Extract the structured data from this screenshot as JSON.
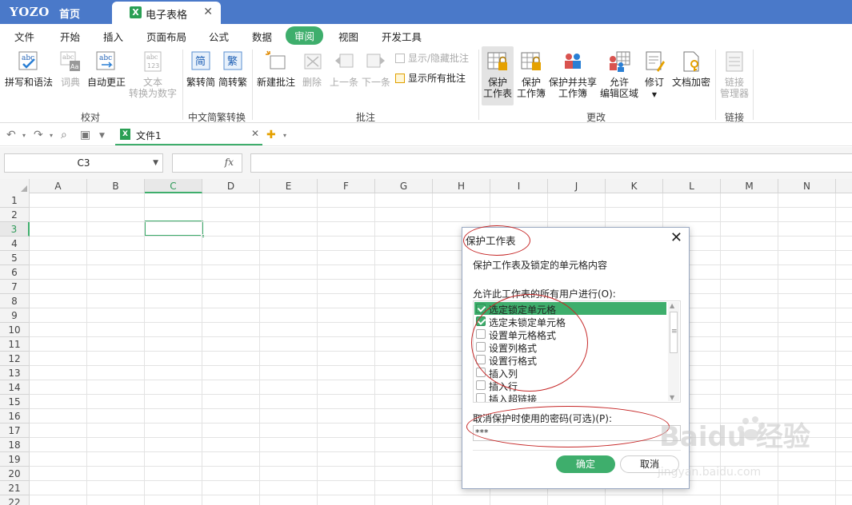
{
  "titlebar": {
    "logo": "YOZO",
    "home_tab": "首页",
    "doc_tab": "电子表格",
    "close_glyph": "✕",
    "bg_color": "#4a79c9"
  },
  "menu": {
    "items": [
      "文件",
      "开始",
      "插入",
      "页面布局",
      "公式",
      "数据",
      "审阅",
      "视图",
      "开发工具"
    ],
    "active": "审阅"
  },
  "ribbon": {
    "proofing": {
      "spell": "拼写和语法",
      "dict": "词典",
      "autocorrect": "自动更正",
      "text_convert_1": "文本",
      "text_convert_2": "转换为数字",
      "label": "校对"
    },
    "chinese": {
      "trad": "繁转简",
      "simp": "简转繁",
      "label": "中文简繁转换"
    },
    "comments": {
      "new": "新建批注",
      "delete": "删除",
      "prev": "上一条",
      "next": "下一条",
      "show_hide": "显示/隐藏批注",
      "show_all": "显示所有批注",
      "label": "批注"
    },
    "changes": {
      "protect_sheet_1": "保护",
      "protect_sheet_2": "工作表",
      "protect_book_1": "保护",
      "protect_book_2": "工作簿",
      "share_1": "保护并共享",
      "share_2": "工作簿",
      "allow_1": "允许",
      "allow_2": "编辑区域",
      "revise": "修订",
      "encrypt": "文档加密",
      "label": "更改"
    },
    "links": {
      "manager_1": "链接",
      "manager_2": "管理器",
      "label": "链接"
    }
  },
  "quickbar": {
    "file_tab": "文件1",
    "close_glyph": "✕"
  },
  "formula_bar": {
    "name_box": "C3",
    "fx": "fx",
    "formula": ""
  },
  "grid": {
    "columns": [
      "A",
      "B",
      "C",
      "D",
      "E",
      "F",
      "G",
      "H",
      "I",
      "J",
      "K",
      "L",
      "M",
      "N"
    ],
    "rows": [
      "1",
      "2",
      "3",
      "4",
      "5",
      "6",
      "7",
      "8",
      "9",
      "10",
      "11",
      "12",
      "13",
      "14",
      "15",
      "16",
      "17",
      "18",
      "19",
      "20",
      "21",
      "22"
    ],
    "active_column": "C",
    "active_row": "3"
  },
  "dialog": {
    "title": "保护工作表",
    "close_glyph": "✕",
    "description": "保护工作表及锁定的单元格内容",
    "allow_label": "允许此工作表的所有用户进行(O):",
    "permissions": [
      {
        "label": "选定锁定单元格",
        "checked": true
      },
      {
        "label": "选定未锁定单元格",
        "checked": true
      },
      {
        "label": "设置单元格格式",
        "checked": false
      },
      {
        "label": "设置列格式",
        "checked": false
      },
      {
        "label": "设置行格式",
        "checked": false
      },
      {
        "label": "插入列",
        "checked": false
      },
      {
        "label": "插入行",
        "checked": false
      },
      {
        "label": "插入超链接",
        "checked": false
      }
    ],
    "password_label": "取消保护时使用的密码(可选)(P):",
    "password_value": "***",
    "ok": "确定",
    "cancel": "取消"
  },
  "watermark": {
    "brand": "Baidu 经验",
    "url": "jingyan.baidu.com"
  },
  "colors": {
    "accent_green": "#3eae6c",
    "annotation_red": "#c62828"
  }
}
